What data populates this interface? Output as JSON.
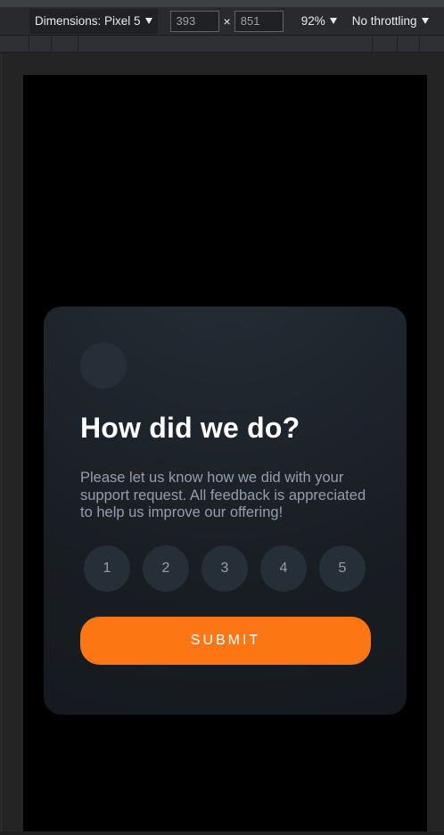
{
  "devtools": {
    "dimensions_label": "Dimensions: Pixel 5",
    "width_value": "393",
    "height_value": "851",
    "times_symbol": "×",
    "zoom_label": "92%",
    "throttling_label": "No throttling"
  },
  "card": {
    "title": "How did we do?",
    "description": "Please let us know how we did with your support request. All feedback is appreciated to help us improve our offering!",
    "ratings": [
      "1",
      "2",
      "3",
      "4",
      "5"
    ],
    "submit_label": "SUBMIT"
  },
  "colors": {
    "accent": "#fc7614",
    "card_bg": "#181d22",
    "muted_text": "#959eac"
  }
}
